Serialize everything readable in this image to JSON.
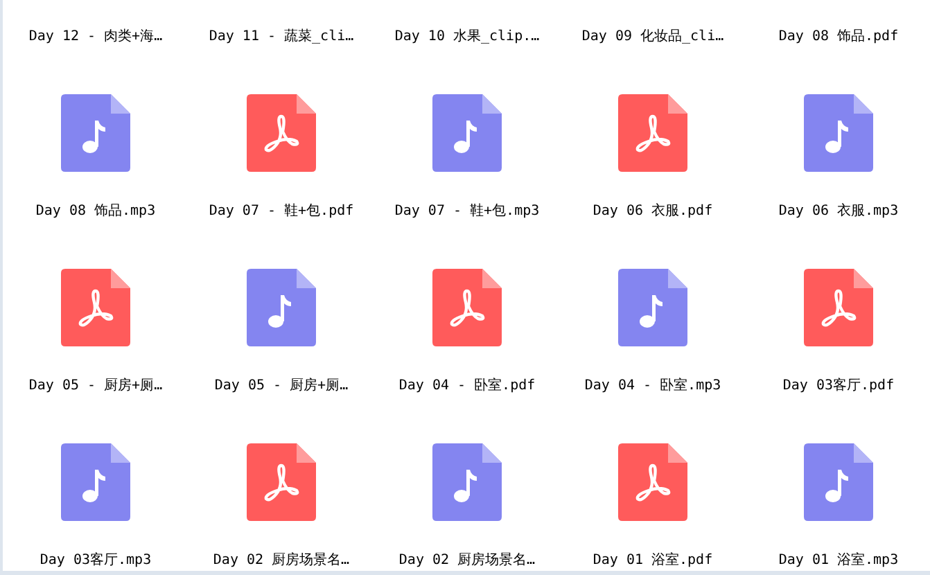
{
  "top_row_labels": [
    "Day 12 - 肉类+海…",
    "Day 11 - 蔬菜_cli…",
    "Day 10 水果_clip.…",
    "Day 09 化妆品_cli…",
    "Day 08 饰品.pdf"
  ],
  "files": [
    {
      "name": "Day 08 饰品.mp3",
      "kind": "audio"
    },
    {
      "name": "Day 07 - 鞋+包.pdf",
      "kind": "pdf"
    },
    {
      "name": "Day 07 - 鞋+包.mp3",
      "kind": "audio"
    },
    {
      "name": "Day 06 衣服.pdf",
      "kind": "pdf"
    },
    {
      "name": "Day 06 衣服.mp3",
      "kind": "audio"
    },
    {
      "name": "Day 05 - 厨房+厕…",
      "kind": "pdf"
    },
    {
      "name": "Day 05 - 厨房+厕…",
      "kind": "audio"
    },
    {
      "name": "Day 04 - 卧室.pdf",
      "kind": "pdf"
    },
    {
      "name": "Day 04 - 卧室.mp3",
      "kind": "audio"
    },
    {
      "name": "Day 03客厅.pdf",
      "kind": "pdf"
    },
    {
      "name": "Day 03客厅.mp3",
      "kind": "audio"
    },
    {
      "name": "Day 02 厨房场景名…",
      "kind": "pdf"
    },
    {
      "name": "Day 02 厨房场景名…",
      "kind": "audio"
    },
    {
      "name": "Day 01 浴室.pdf",
      "kind": "pdf"
    },
    {
      "name": "Day 01 浴室.mp3",
      "kind": "audio"
    }
  ]
}
